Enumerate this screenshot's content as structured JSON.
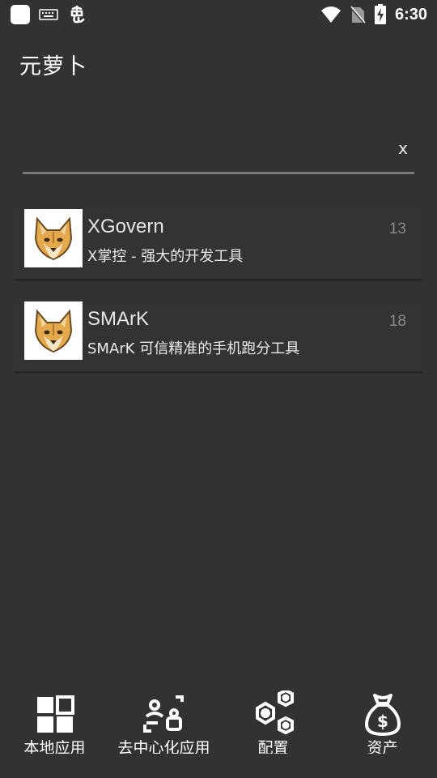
{
  "status_bar": {
    "time": "6:30",
    "left_icons": [
      "square-notification-icon",
      "keyboard-icon",
      "bug-icon"
    ],
    "right_icons": [
      "wifi-icon",
      "no-sim-icon",
      "battery-charging-icon"
    ]
  },
  "header": {
    "title": "元萝卜"
  },
  "search": {
    "value": "",
    "clear_label": "x"
  },
  "apps": [
    {
      "name": "XGovern",
      "description": "X掌控 - 强大的开发工具",
      "count": "13",
      "icon": "fox-logo-icon"
    },
    {
      "name": "SMArK",
      "description": "SMArK 可信精准的手机跑分工具",
      "count": "18",
      "icon": "fox-logo-icon"
    }
  ],
  "bottom_nav": [
    {
      "label": "本地应用",
      "icon": "grid-icon"
    },
    {
      "label": "去中心化应用",
      "icon": "decentralized-icon"
    },
    {
      "label": "配置",
      "icon": "hexagon-settings-icon"
    },
    {
      "label": "资产",
      "icon": "money-bag-icon"
    }
  ],
  "colors": {
    "background": "#323232",
    "text": "#ffffff",
    "count": "#8a8a8a",
    "divider": "#7a7a7a"
  }
}
